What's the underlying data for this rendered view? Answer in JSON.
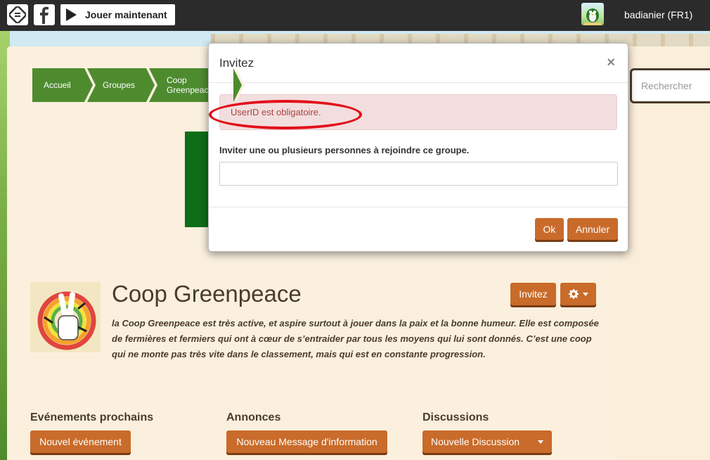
{
  "topbar": {
    "play_label": "Jouer maintenant",
    "username": "badianier (FR1)"
  },
  "search": {
    "placeholder": "Rechercher"
  },
  "breadcrumbs": [
    {
      "label": "Accueil"
    },
    {
      "label": "Groupes"
    },
    {
      "label": "Coop Greenpeace"
    }
  ],
  "group": {
    "title": "Coop Greenpeace",
    "description": "la Coop Greenpeace est très active, et aspire surtout à jouer dans la paix et la bonne humeur. Elle est composée de fermières et fermiers qui ont à cœur de s’entraider par tous les moyens qui lui sont donnés. C’est une coop qui ne monte pas très vite dans le classement, mais qui est en constante progression.",
    "invite_button": "Invitez"
  },
  "sections": [
    {
      "title": "Evénements prochains",
      "button": "Nouvel événement"
    },
    {
      "title": "Annonces",
      "button": "Nouveau Message d'information"
    },
    {
      "title": "Discussions",
      "button": "Nouvelle Discussion"
    }
  ],
  "modal": {
    "title": "Invitez",
    "close": "×",
    "error": "UserID est obligatoire.",
    "label": "Inviter une ou plusieurs personnes à rejoindre ce groupe.",
    "input_value": "",
    "ok": "Ok",
    "cancel": "Annuler"
  },
  "colors": {
    "breadcrumb": "#4e8b2f",
    "button": "#c96b2a",
    "alert_bg": "#f2dede",
    "alert_text": "#a94442",
    "annotation": "#e2101a"
  }
}
